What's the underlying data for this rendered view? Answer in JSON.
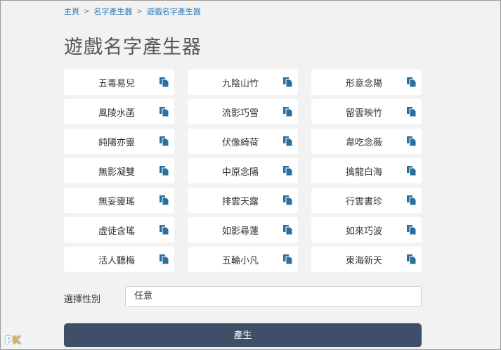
{
  "breadcrumb": {
    "items": [
      "主頁",
      "名字產生器",
      "遊戲名字產生器"
    ],
    "separator": ">"
  },
  "page": {
    "title": "遊戲名字產生器"
  },
  "names": [
    "五毒易兒",
    "九陰山竹",
    "形意念陽",
    "風陵水菡",
    "流影巧雪",
    "留雲映竹",
    "純陽亦靈",
    "伏像綺荷",
    "韋吃念薇",
    "無影凝雙",
    "中原念陽",
    "擒龍白海",
    "無妄靈瑤",
    "排雲天露",
    "行雲書珍",
    "虛徒含瑤",
    "如影尋蓮",
    "如來巧波",
    "活人聽梅",
    "五輪小凡",
    "東海新天"
  ],
  "copy_icon": "copy-icon",
  "gender": {
    "label": "選擇性別",
    "value": "任意"
  },
  "generate_button": {
    "label": "產生"
  },
  "watermark": "PK",
  "colors": {
    "background": "#f2f2f2",
    "link": "#2b7bb9",
    "button": "#3d5068",
    "icon": "#2b6f9f"
  }
}
